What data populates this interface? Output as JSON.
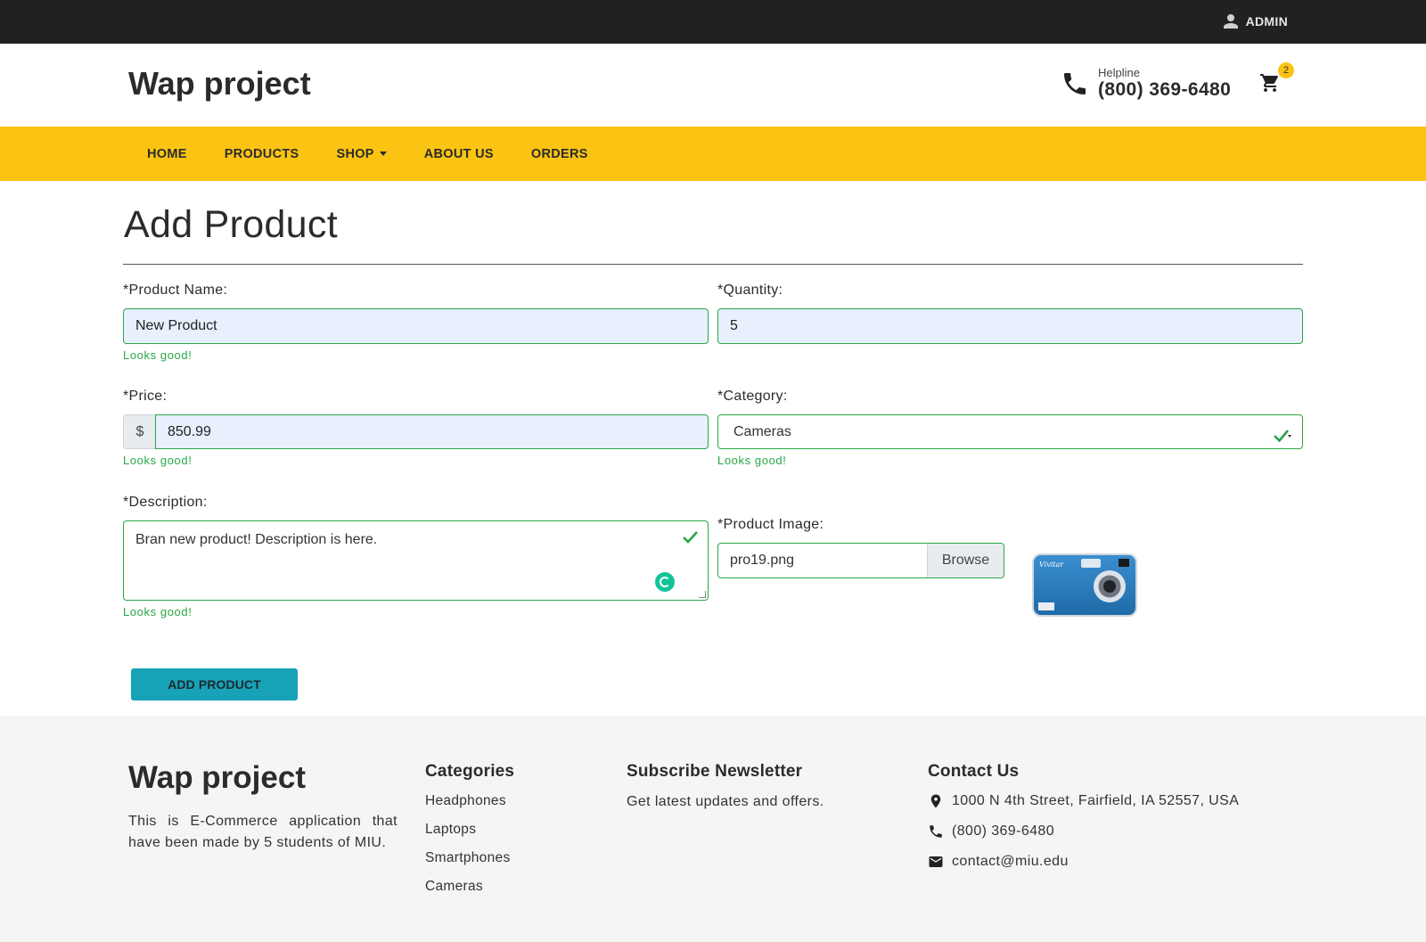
{
  "topbar": {
    "admin_label": "ADMIN"
  },
  "header": {
    "logo": "Wap project",
    "helpline_label": "Helpline",
    "helpline_number": "(800) 369-6480",
    "cart_count": "2"
  },
  "nav": {
    "items": [
      {
        "label": "HOME"
      },
      {
        "label": "PRODUCTS"
      },
      {
        "label": "SHOP"
      },
      {
        "label": "ABOUT US"
      },
      {
        "label": "ORDERS"
      }
    ]
  },
  "form": {
    "title": "Add Product",
    "product_name": {
      "label": "*Product Name:",
      "value": "New Product",
      "feedback": "Looks good!"
    },
    "quantity": {
      "label": "*Quantity:",
      "value": "5"
    },
    "price": {
      "label": "*Price:",
      "prefix": "$",
      "value": "850.99",
      "feedback": "Looks good!"
    },
    "category": {
      "label": "*Category:",
      "selected": "Cameras",
      "feedback": "Looks good!"
    },
    "description": {
      "label": "*Description:",
      "value": "Bran new product! Description is here.",
      "feedback": "Looks good!"
    },
    "image": {
      "label": "*Product Image:",
      "filename": "pro19.png",
      "browse_label": "Browse",
      "thumbnail_brand": "Vivitar"
    },
    "submit_label": "ADD PRODUCT"
  },
  "footer": {
    "logo": "Wap project",
    "about": "This is E-Commerce application that have been made by 5 students of MIU.",
    "categories": {
      "heading": "Categories",
      "items": [
        "Headphones",
        "Laptops",
        "Smartphones",
        "Cameras"
      ]
    },
    "newsletter": {
      "heading": "Subscribe Newsletter",
      "text": "Get latest updates and offers."
    },
    "contact": {
      "heading": "Contact Us",
      "address": "1000 N 4th Street, Fairfield, IA 52557, USA",
      "phone": "(800) 369-6480",
      "email": "contact@miu.edu"
    }
  },
  "colors": {
    "nav_bg": "#fbc312",
    "topbar_bg": "#212121",
    "valid_green": "#28a745",
    "button_teal": "#17a2b8",
    "footer_bg": "#f5f5f5"
  }
}
